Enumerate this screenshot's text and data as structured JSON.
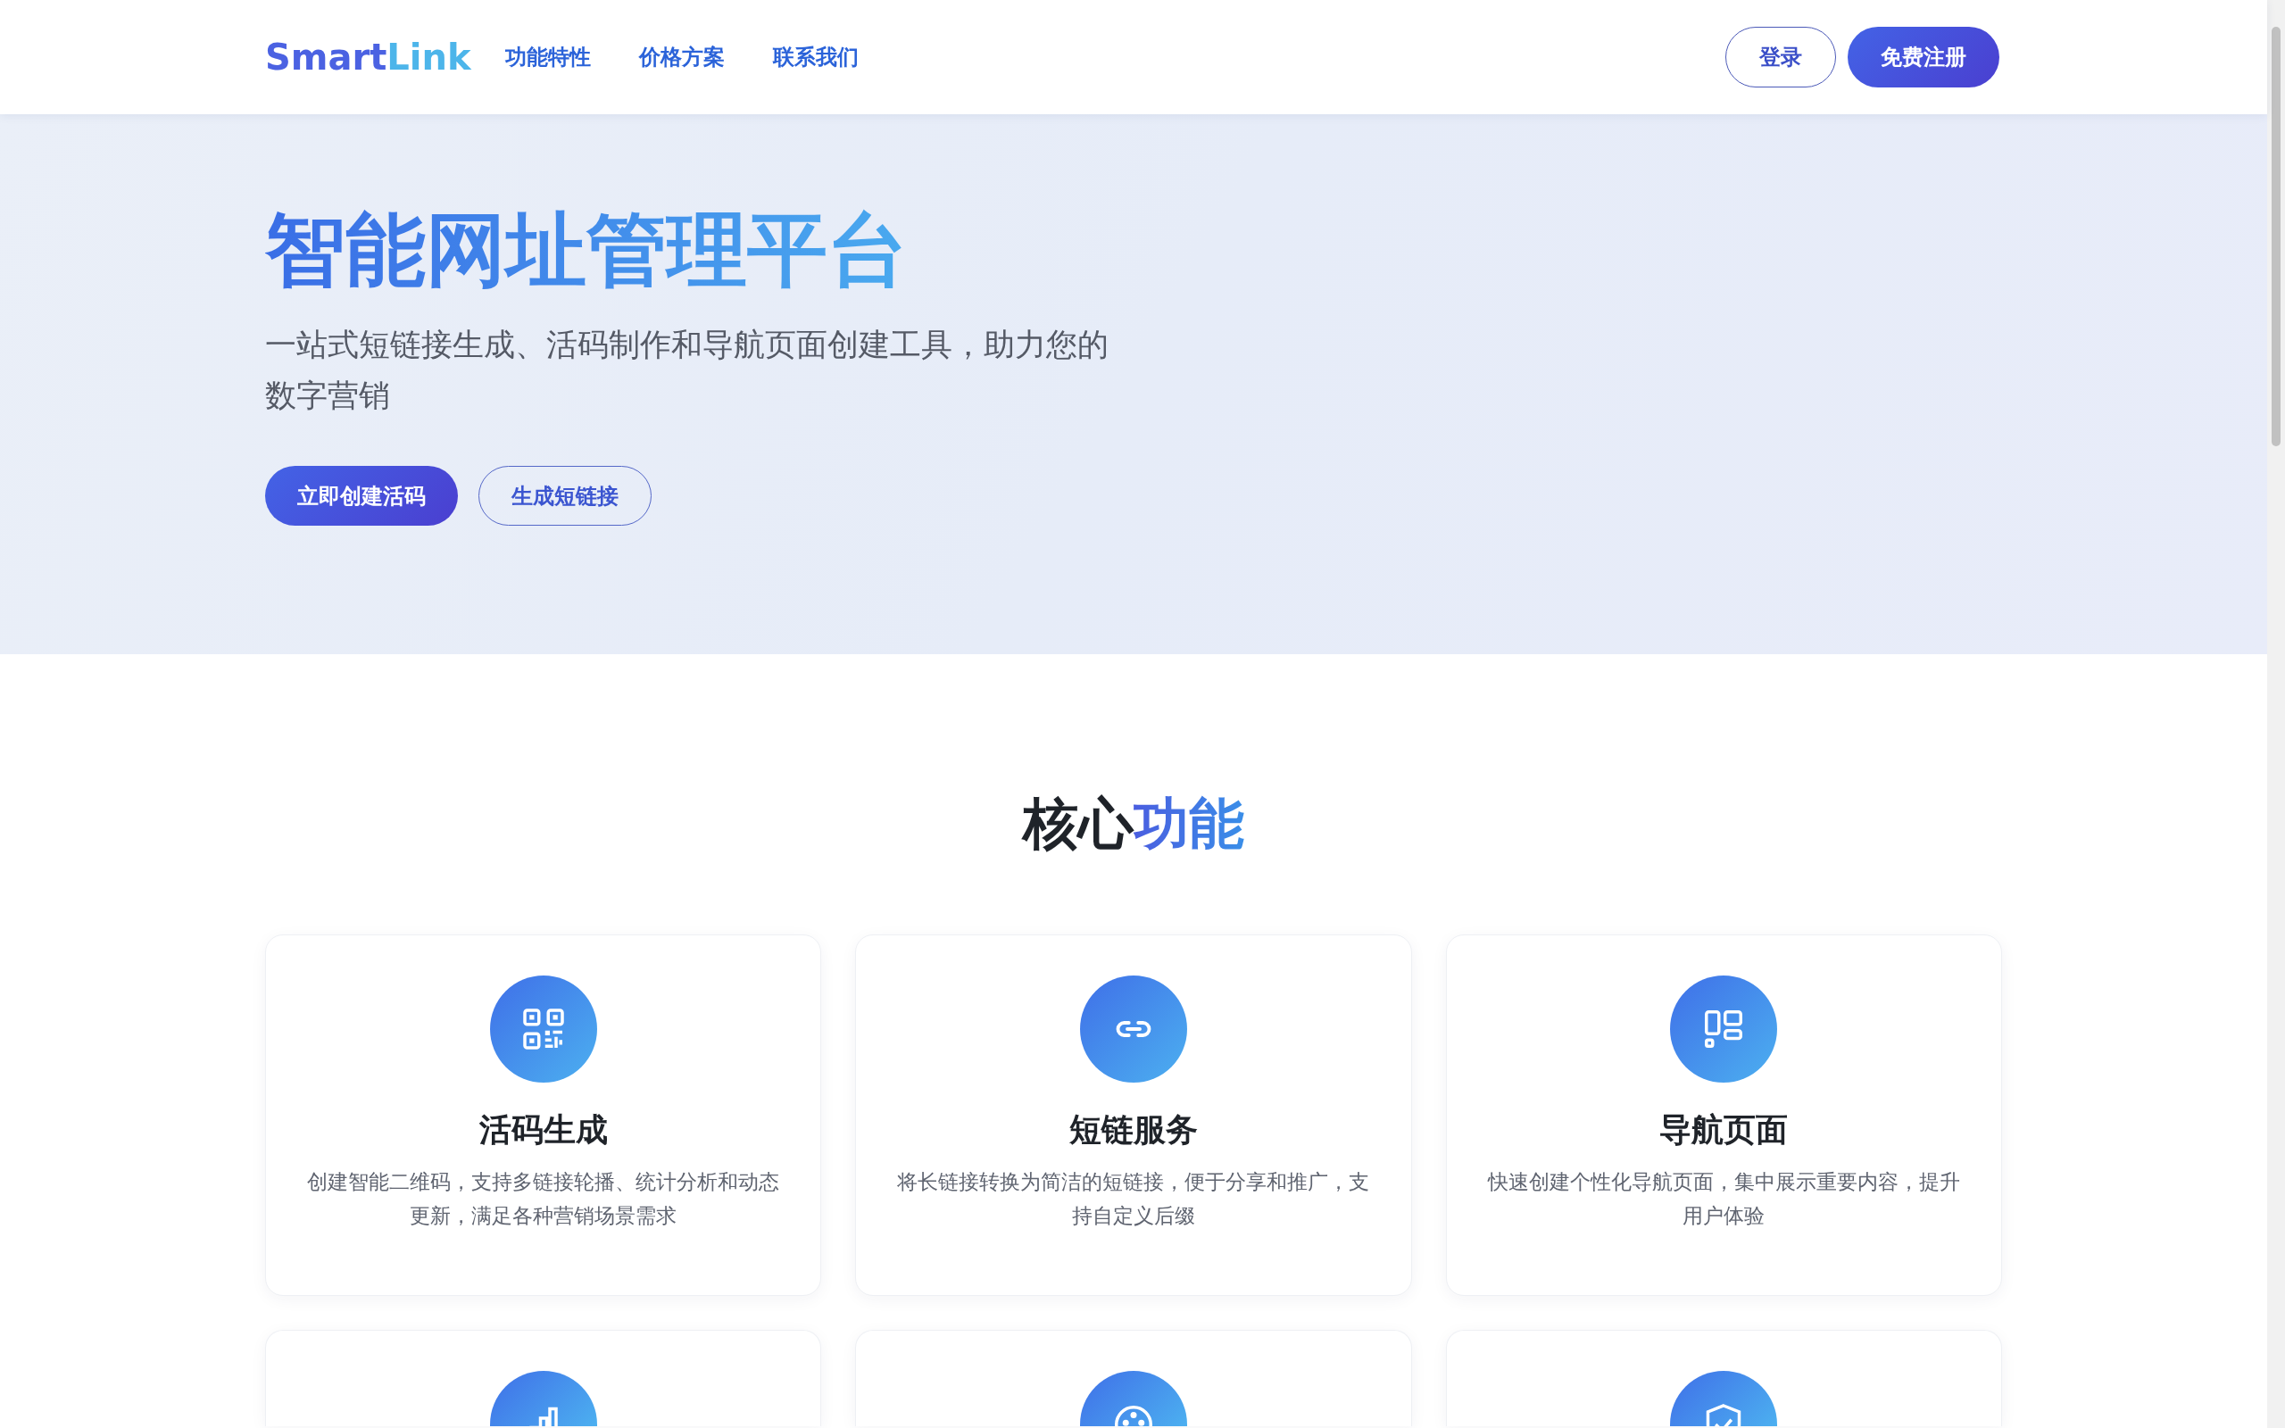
{
  "header": {
    "logo": {
      "part_1": "Smart",
      "part_2": "Link"
    },
    "nav": [
      {
        "label": "功能特性"
      },
      {
        "label": "价格方案"
      },
      {
        "label": "联系我们"
      }
    ],
    "login": "登录",
    "signup": "免费注册"
  },
  "hero": {
    "title": "智能网址管理平台",
    "subtitle": "一站式短链接生成、活码制作和导航页面创建工具，助力您的数字营销",
    "buttons": [
      {
        "label": "立即创建活码",
        "kind": "primary"
      },
      {
        "label": "生成短链接",
        "kind": "outline"
      }
    ]
  },
  "features": {
    "title_plain": "核心",
    "title_highlight": "功能",
    "cards": [
      {
        "title": "活码生成",
        "description": "创建智能二维码，支持多链接轮播、统计分析和动态更新，满足各种营销场景需求"
      },
      {
        "title": "短链服务",
        "description": "将长链接转换为简洁的短链接，便于分享和推广，支持自定义后缀"
      },
      {
        "title": "导航页面",
        "description": "快速创建个性化导航页面，集中展示重要内容，提升用户体验"
      }
    ]
  }
}
